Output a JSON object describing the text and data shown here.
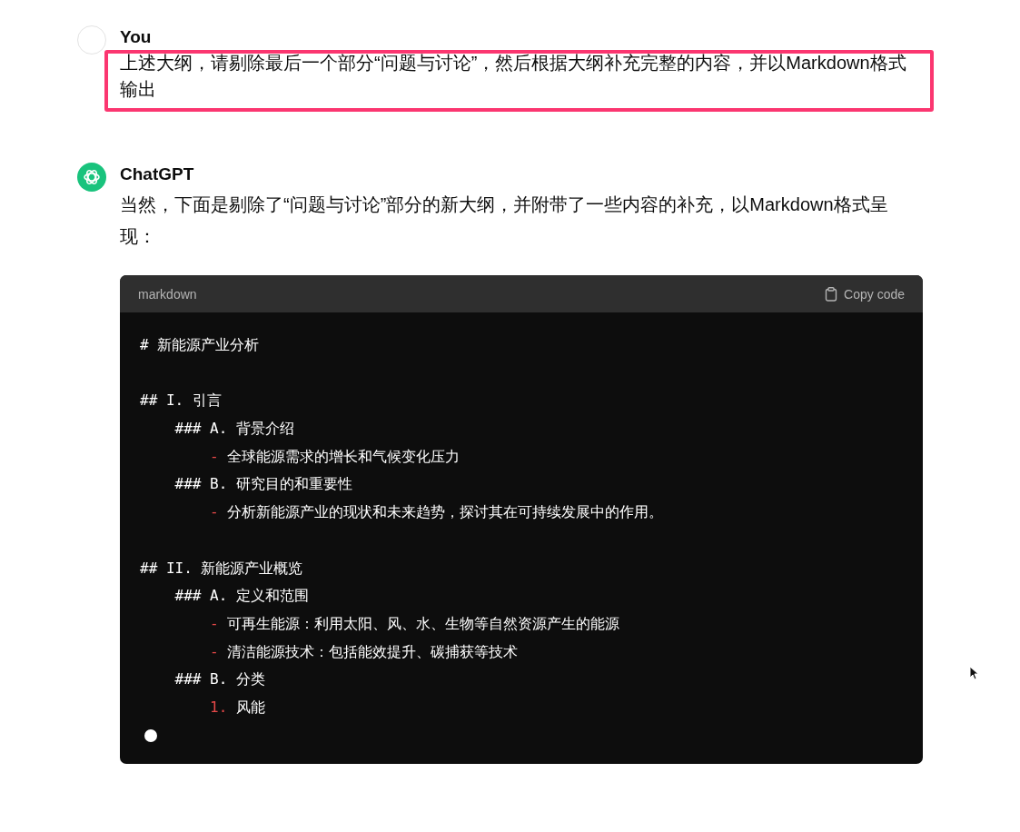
{
  "messages": [
    {
      "kind": "user",
      "author": "You",
      "text": "上述大纲，请剔除最后一个部分“问题与讨论”，然后根据大纲补充完整的内容，并以Markdown格式输出",
      "highlighted": true
    },
    {
      "kind": "assistant",
      "author": "ChatGPT",
      "text": "当然，下面是剔除了“问题与讨论”部分的新大纲，并附带了一些内容的补充，以Markdown格式呈现：",
      "code_block": {
        "language": "markdown",
        "copy_label": "Copy code",
        "streaming": true,
        "lines": [
          {
            "kind": "heading",
            "marker": "#",
            "text": "新能源产业分析"
          },
          {
            "kind": "blank"
          },
          {
            "kind": "heading",
            "marker": "## I.",
            "text": "引言"
          },
          {
            "kind": "subheading",
            "marker": "### A.",
            "text": "背景介绍"
          },
          {
            "kind": "bullet",
            "marker": "-",
            "text": "全球能源需求的增长和气候变化压力"
          },
          {
            "kind": "subheading",
            "marker": "### B.",
            "text": "研究目的和重要性"
          },
          {
            "kind": "bullet",
            "marker": "-",
            "text": "分析新能源产业的现状和未来趋势，探讨其在可持续发展中的作用。"
          },
          {
            "kind": "blank"
          },
          {
            "kind": "heading",
            "marker": "## II.",
            "text": "新能源产业概览"
          },
          {
            "kind": "subheading",
            "marker": "### A.",
            "text": "定义和范围"
          },
          {
            "kind": "bullet",
            "marker": "-",
            "text": "可再生能源：利用太阳、风、水、生物等自然资源产生的能源"
          },
          {
            "kind": "bullet",
            "marker": "-",
            "text": "清洁能源技术：包括能效提升、碳捕获等技术"
          },
          {
            "kind": "subheading",
            "marker": "### B.",
            "text": "分类"
          },
          {
            "kind": "numbered",
            "marker": "1.",
            "text": "风能"
          }
        ]
      }
    }
  ]
}
